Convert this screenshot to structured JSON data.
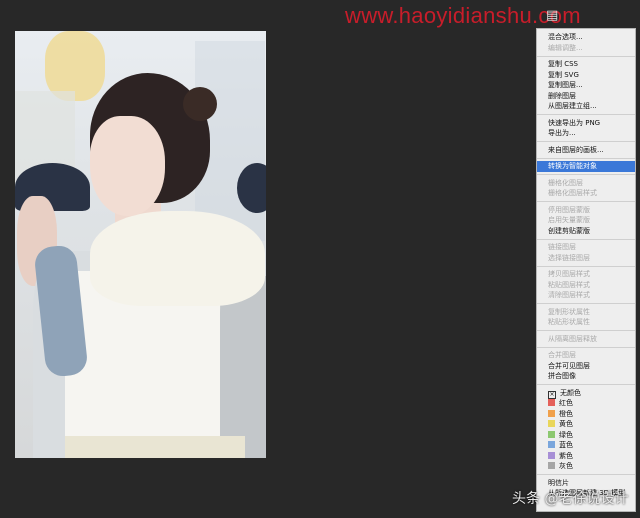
{
  "watermark": "www.haoyidianshu.com",
  "weibo_watermark": "头条 @老徐说设计",
  "context_menu": {
    "items": [
      {
        "label": "混合选项...",
        "disabled": false
      },
      {
        "label": "编辑调整...",
        "disabled": true
      },
      {
        "sep": true
      },
      {
        "label": "复制 CSS",
        "disabled": false
      },
      {
        "label": "复制 SVG",
        "disabled": false
      },
      {
        "label": "复制图层...",
        "disabled": false
      },
      {
        "label": "删除图层",
        "disabled": false
      },
      {
        "label": "从图层建立组...",
        "disabled": false
      },
      {
        "sep": true
      },
      {
        "label": "快速导出为 PNG",
        "disabled": false
      },
      {
        "label": "导出为...",
        "disabled": false
      },
      {
        "sep": true
      },
      {
        "label": "来自图层的画板...",
        "disabled": false
      },
      {
        "sep": true
      },
      {
        "label": "转换为智能对象",
        "disabled": false,
        "highlighted": true
      },
      {
        "sep": true
      },
      {
        "label": "栅格化图层",
        "disabled": true
      },
      {
        "label": "栅格化图层样式",
        "disabled": true
      },
      {
        "sep": true
      },
      {
        "label": "停用图层蒙版",
        "disabled": true
      },
      {
        "label": "启用矢量蒙版",
        "disabled": true
      },
      {
        "label": "创建剪贴蒙版",
        "disabled": false
      },
      {
        "sep": true
      },
      {
        "label": "链接图层",
        "disabled": true
      },
      {
        "label": "选择链接图层",
        "disabled": true
      },
      {
        "sep": true
      },
      {
        "label": "拷贝图层样式",
        "disabled": true
      },
      {
        "label": "粘贴图层样式",
        "disabled": true
      },
      {
        "label": "清除图层样式",
        "disabled": true
      },
      {
        "sep": true
      },
      {
        "label": "复制形状属性",
        "disabled": true
      },
      {
        "label": "粘贴形状属性",
        "disabled": true
      },
      {
        "sep": true
      },
      {
        "label": "从隔离图层释放",
        "disabled": true
      },
      {
        "sep": true
      },
      {
        "label": "合并图层",
        "disabled": true
      },
      {
        "label": "合并可见图层",
        "disabled": false
      },
      {
        "label": "拼合图像",
        "disabled": false
      },
      {
        "sep": true
      },
      {
        "label": "无颜色",
        "none": true
      },
      {
        "label": "红色",
        "color": "#e4605a"
      },
      {
        "label": "橙色",
        "color": "#f0a04a"
      },
      {
        "label": "黄色",
        "color": "#e9d65a"
      },
      {
        "label": "绿色",
        "color": "#8cc870"
      },
      {
        "label": "蓝色",
        "color": "#7aa6dc"
      },
      {
        "label": "紫色",
        "color": "#a78fd6"
      },
      {
        "label": "灰色",
        "color": "#a6a6a6"
      },
      {
        "sep": true
      },
      {
        "label": "明信片",
        "disabled": false
      },
      {
        "label": "从所选图层新建 3D 模型",
        "disabled": false
      }
    ]
  },
  "colors": {
    "highlight": "#3b78d8",
    "watermark": "#c81d2a"
  }
}
